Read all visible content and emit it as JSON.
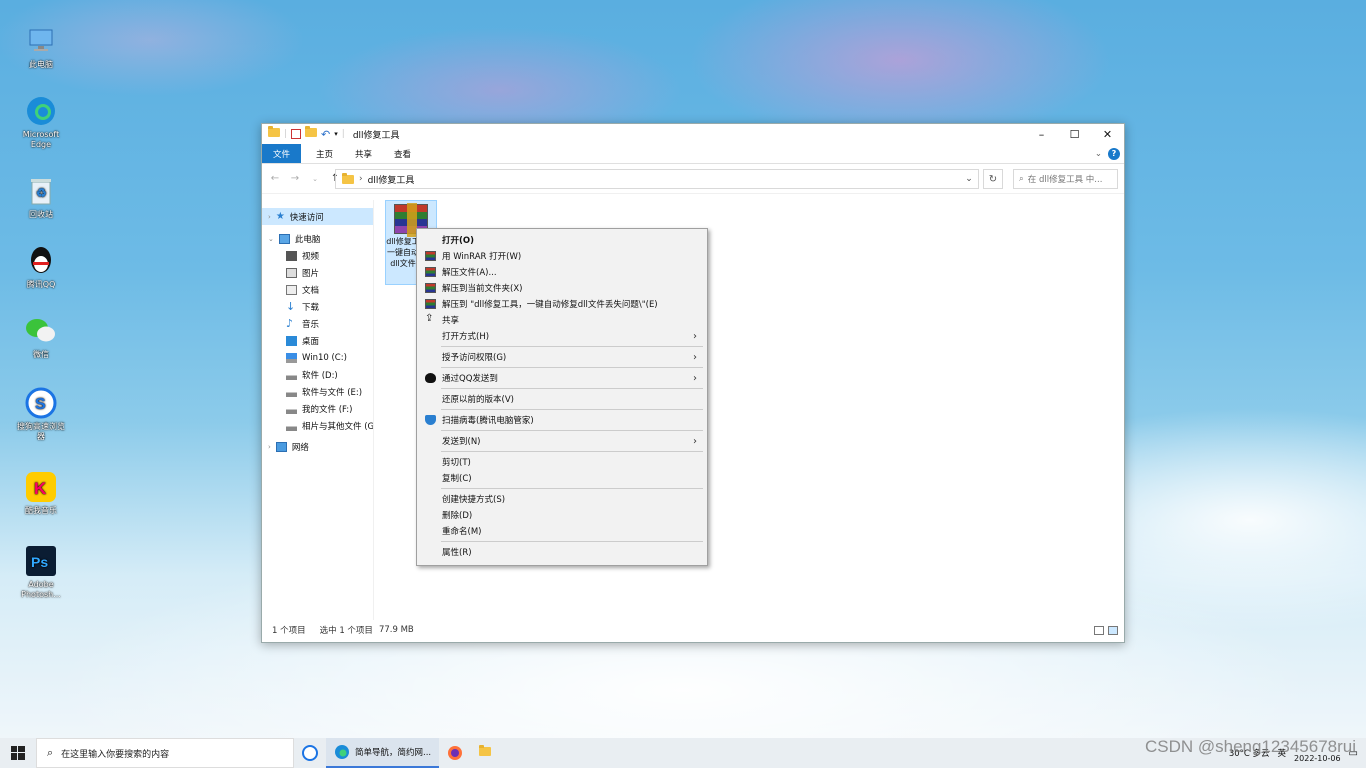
{
  "desktop": {
    "icons": [
      {
        "label": "此电脑",
        "icon": "computer-icon"
      },
      {
        "label": "Microsoft Edge",
        "icon": "edge-icon"
      },
      {
        "label": "回收站",
        "icon": "recycle-bin-icon"
      },
      {
        "label": "腾讯QQ",
        "icon": "qq-icon"
      },
      {
        "label": "微信",
        "icon": "wechat-icon"
      },
      {
        "label": "搜狗高速浏览器",
        "icon": "sogou-browser-icon"
      },
      {
        "label": "酷我音乐",
        "icon": "kuwo-music-icon"
      },
      {
        "label": "Adobe Photosh...",
        "icon": "photoshop-icon"
      }
    ]
  },
  "window": {
    "title": "dll修复工具",
    "ribbon_tabs": [
      "文件",
      "主页",
      "共享",
      "查看"
    ],
    "path": "dll修复工具",
    "search_placeholder": "在 dll修复工具 中...",
    "nav": {
      "quick_access": "快速访问",
      "this_pc": "此电脑",
      "items": [
        "视频",
        "图片",
        "文档",
        "下载",
        "音乐",
        "桌面",
        "Win10 (C:)",
        "软件 (D:)",
        "软件与文件 (E:)",
        "我的文件 (F:)",
        "相片与其他文件 (G:"
      ],
      "network": "网络"
    },
    "file": {
      "label": "dll修复工具，一键自动修复dll文件丢失"
    },
    "status": {
      "count": "1 个项目",
      "selected": "选中 1 个项目",
      "size": "77.9 MB"
    }
  },
  "context_menu": {
    "items": [
      "打开(O)",
      "用 WinRAR 打开(W)",
      "解压文件(A)...",
      "解压到当前文件夹(X)",
      "解压到 \"dll修复工具，一键自动修复dll文件丢失问题\\\"(E)",
      "共享",
      "打开方式(H)",
      "授予访问权限(G)",
      "通过QQ发送到",
      "还原以前的版本(V)",
      "扫描病毒(腾讯电脑管家)",
      "发送到(N)",
      "剪切(T)",
      "复制(C)",
      "创建快捷方式(S)",
      "删除(D)",
      "重命名(M)",
      "属性(R)"
    ]
  },
  "taskbar": {
    "search_placeholder": "在这里输入你要搜索的内容",
    "edge_task": "简单导航，简约网...",
    "weather": "30°C 多云",
    "ime": "英",
    "date": "2022-10-06",
    "watermark": "CSDN @sheng12345678rui"
  },
  "colors": {
    "accent": "#1979ca",
    "selection": "#cce8ff"
  }
}
